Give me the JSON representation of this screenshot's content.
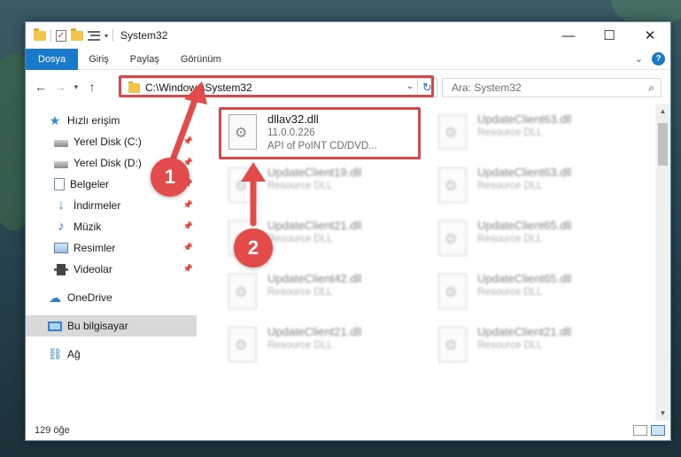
{
  "window": {
    "title": "System32"
  },
  "ribbon": {
    "tabs": [
      "Dosya",
      "Giriş",
      "Paylaş",
      "Görünüm"
    ]
  },
  "address": {
    "path": "C:\\Windows\\System32"
  },
  "search": {
    "placeholder": "Ara: System32"
  },
  "sidebar": {
    "quick_access": "Hızlı erişim",
    "items": [
      {
        "label": "Yerel Disk (C:)",
        "icon": "drive-icon",
        "pinned": true
      },
      {
        "label": "Yerel Disk (D:)",
        "icon": "drive-icon",
        "pinned": true
      },
      {
        "label": "Belgeler",
        "icon": "documents-icon",
        "pinned": true
      },
      {
        "label": "İndirmeler",
        "icon": "downloads-icon",
        "pinned": true
      },
      {
        "label": "Müzik",
        "icon": "music-icon",
        "pinned": true
      },
      {
        "label": "Resimler",
        "icon": "pictures-icon",
        "pinned": true
      },
      {
        "label": "Videolar",
        "icon": "videos-icon",
        "pinned": true
      }
    ],
    "onedrive": "OneDrive",
    "this_pc": "Bu bilgisayar",
    "network": "Ağ"
  },
  "files": [
    {
      "name": "dllav32.dll",
      "version": "11.0.0.226",
      "description": "API of PoINT CD/DVD...",
      "highlighted": true
    },
    {
      "name": "UpdateClient63.dll",
      "description": "Resource DLL"
    },
    {
      "name": "UpdateClient19.dll",
      "description": "Resource DLL"
    },
    {
      "name": "UpdateClient63.dll",
      "description": "Resource DLL"
    },
    {
      "name": "UpdateClient21.dll",
      "description": "Resource DLL"
    },
    {
      "name": "UpdateClient65.dll",
      "description": "Resource DLL"
    },
    {
      "name": "UpdateClient42.dll",
      "description": "Resource DLL"
    },
    {
      "name": "UpdateClient65.dll",
      "description": "Resource DLL"
    },
    {
      "name": "UpdateClient21.dll",
      "description": "Resource DLL"
    },
    {
      "name": "UpdateClient21.dll",
      "description": "Resource DLL"
    }
  ],
  "status": {
    "count": "129 öğe"
  },
  "annotations": {
    "step1": "1",
    "step2": "2"
  },
  "colors": {
    "accent": "#1979ca",
    "highlight": "#d9474a",
    "badge": "#e34a4a"
  }
}
